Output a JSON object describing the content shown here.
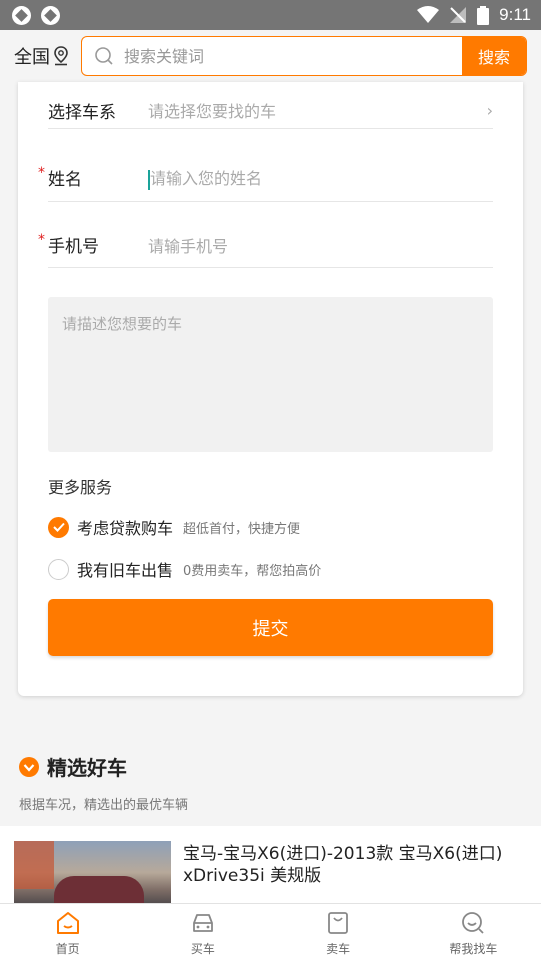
{
  "status_bar": {
    "time": "9:11"
  },
  "header": {
    "region": "全国",
    "search_placeholder": "搜索关键词",
    "search_button": "搜索"
  },
  "form": {
    "series": {
      "label": "选择车系",
      "placeholder": "请选择您要找的车"
    },
    "name": {
      "label": "姓名",
      "placeholder": "请输入您的姓名",
      "required_mark": "*"
    },
    "phone": {
      "label": "手机号",
      "placeholder": "请输手机号",
      "required_mark": "*"
    },
    "description_placeholder": "请描述您想要的车",
    "more_services_title": "更多服务",
    "options": [
      {
        "label": "考虑贷款购车",
        "sub": "超低首付，快捷方便",
        "checked": true
      },
      {
        "label": "我有旧车出售",
        "sub": "0费用卖车，帮您拍高价",
        "checked": false
      }
    ],
    "submit_label": "提交"
  },
  "section": {
    "title": "精选好车",
    "subtitle": "根据车况，精选出的最优车辆"
  },
  "cars": [
    {
      "title": "宝马-宝马X6(进口)-2013款 宝马X6(进口) xDrive35i 美规版"
    }
  ],
  "bottom_nav": [
    {
      "label": "首页",
      "icon": "home-icon",
      "active": true
    },
    {
      "label": "买车",
      "icon": "car-icon",
      "active": false
    },
    {
      "label": "卖车",
      "icon": "bag-icon",
      "active": false
    },
    {
      "label": "帮我找车",
      "icon": "search-face-icon",
      "active": false
    }
  ],
  "colors": {
    "accent": "#ff7a00",
    "status_bar": "#757575",
    "required": "#e02020"
  }
}
